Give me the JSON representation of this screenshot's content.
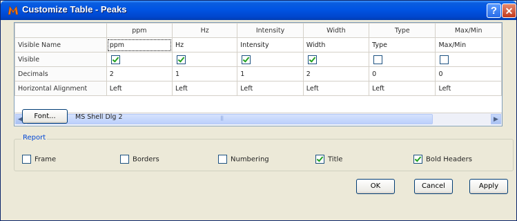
{
  "window": {
    "title": "Customize Table - Peaks",
    "help_glyph": "?",
    "close_glyph": "✕"
  },
  "grid": {
    "columns": [
      "ppm",
      "Hz",
      "Intensity",
      "Width",
      "Type",
      "Max/Min"
    ],
    "rows": [
      {
        "label": "Visible Name",
        "cells": [
          "ppm",
          "Hz",
          "Intensity",
          "Width",
          "Type",
          "Max/Min"
        ]
      },
      {
        "label": "Visible",
        "checks": [
          true,
          true,
          true,
          true,
          false,
          false
        ]
      },
      {
        "label": "Decimals",
        "cells": [
          "2",
          "1",
          "1",
          "2",
          "0",
          "0"
        ]
      },
      {
        "label": "Horizontal Alignment",
        "cells": [
          "Left",
          "Left",
          "Left",
          "Left",
          "Left",
          "Left"
        ]
      }
    ]
  },
  "font": {
    "button_label": "Font...",
    "current": "MS Shell Dlg 2"
  },
  "report": {
    "title": "Report",
    "options": [
      {
        "label": "Frame",
        "checked": false
      },
      {
        "label": "Borders",
        "checked": false
      },
      {
        "label": "Numbering",
        "checked": false
      },
      {
        "label": "Title",
        "checked": true
      },
      {
        "label": "Bold Headers",
        "checked": true
      }
    ]
  },
  "buttons": {
    "ok": "OK",
    "cancel": "Cancel",
    "apply": "Apply"
  },
  "colors": {
    "titlebar": "#0054e3",
    "dialog_bg": "#ece9d8",
    "group_title": "#0046d5",
    "check_mark": "#21a121"
  }
}
